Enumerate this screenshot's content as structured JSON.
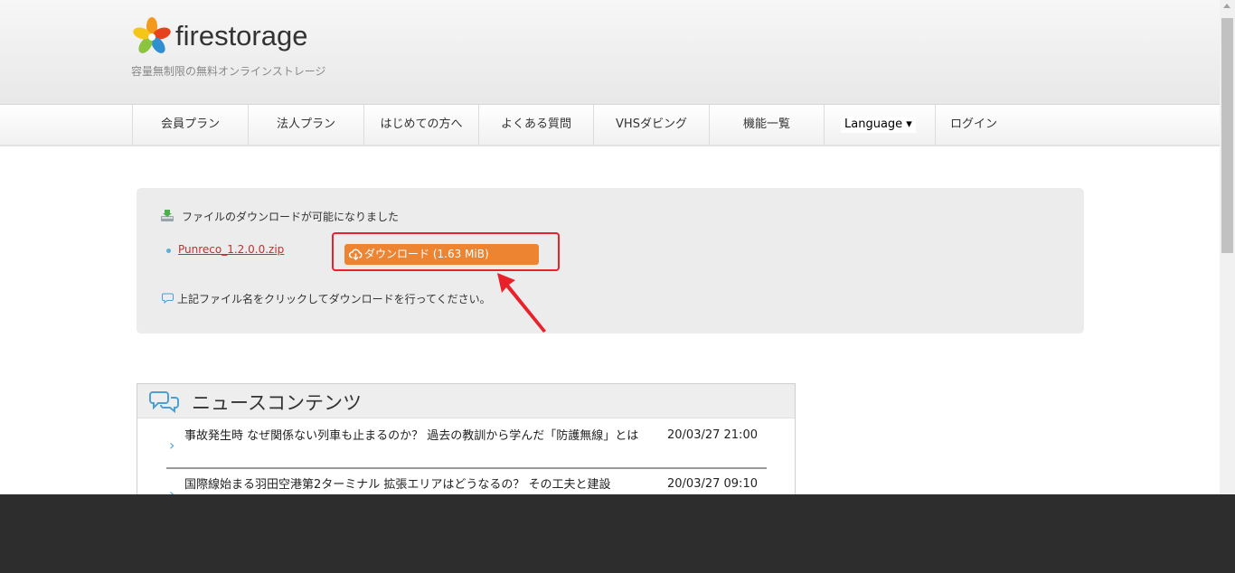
{
  "header": {
    "logo_text": "firestorage",
    "tagline": "容量無制限の無料オンラインストレージ"
  },
  "nav": {
    "items": [
      {
        "label": "会員プラン"
      },
      {
        "label": "法人プラン"
      },
      {
        "label": "はじめての方へ"
      },
      {
        "label": "よくある質問"
      },
      {
        "label": "VHSダビング"
      },
      {
        "label": "機能一覧"
      }
    ],
    "language_label": "Language ▾",
    "login_label": "ログイン"
  },
  "download": {
    "status_text": "ファイルのダウンロードが可能になりました",
    "file_name": "Punreco_1.2.0.0.zip",
    "button_label": "ダウンロード (1.63 MiB)",
    "note": "上記ファイル名をクリックしてダウンロードを行ってください。",
    "button_color": "#ed8432",
    "highlight_color": "#e8212b"
  },
  "news": {
    "title": "ニュースコンテンツ",
    "items": [
      {
        "text": "事故発生時 なぜ関係ない列車も止まるのか？ 過去の教訓から学んだ「防護無線」とは",
        "date": "20/03/27 21:00"
      },
      {
        "text": "国際線始まる羽田空港第2ターミナル 拡張エリアはどうなるの？ その工夫と建設",
        "date": "20/03/27 09:10"
      }
    ]
  }
}
